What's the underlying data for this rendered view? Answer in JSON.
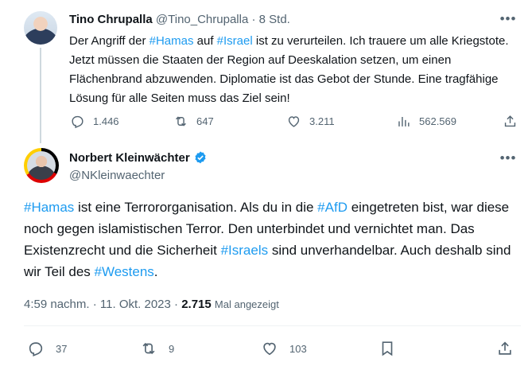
{
  "colors": {
    "accent": "#1d9bf0",
    "muted": "#536471",
    "text": "#0f1419"
  },
  "reply_tweet": {
    "author_name": "Tino Chrupalla",
    "author_handle": "@Tino_Chrupalla",
    "separator": "·",
    "time_ago": "8 Std.",
    "text_parts": {
      "p1": "Der Angriff der ",
      "hashtag_hamas": "#Hamas",
      "p2": " auf ",
      "hashtag_israel": "#Israel",
      "p3": " ist zu verurteilen. Ich trauere um alle Kriegstote. Jetzt müssen die Staaten der Region auf Deeskalation setzen, um einen Flächenbrand abzuwenden. Diplomatie ist das Gebot der Stunde. Eine tragfähige Lösung für alle Seiten muss das Ziel sein!"
    },
    "stats": {
      "replies": "1.446",
      "reposts": "647",
      "likes": "3.211",
      "views": "562.569"
    },
    "more_icon": "more-dots-icon"
  },
  "main_tweet": {
    "author_name": "Norbert Kleinwächter",
    "author_handle": "@NKleinwaechter",
    "text_parts": {
      "hashtag_hamas": "#Hamas",
      "p1": " ist eine Terrororganisation. Als du in die ",
      "hashtag_afd": "#AfD",
      "p2": " eingetreten bist, war diese noch gegen islamistischen Terror. Den unterbindet und vernichtet man. Das Existenzrecht und die Sicherheit ",
      "hashtag_israels": "#Israels",
      "p3": " sind unverhandelbar. Auch deshalb sind wir Teil des ",
      "hashtag_westens": "#Westens",
      "p4": "."
    },
    "time": "4:59 nachm.",
    "separator": "·",
    "date": "11. Okt. 2023",
    "views_count": "2.715",
    "views_label": "Mal angezeigt",
    "stats": {
      "replies": "37",
      "reposts": "9",
      "likes": "103"
    }
  }
}
